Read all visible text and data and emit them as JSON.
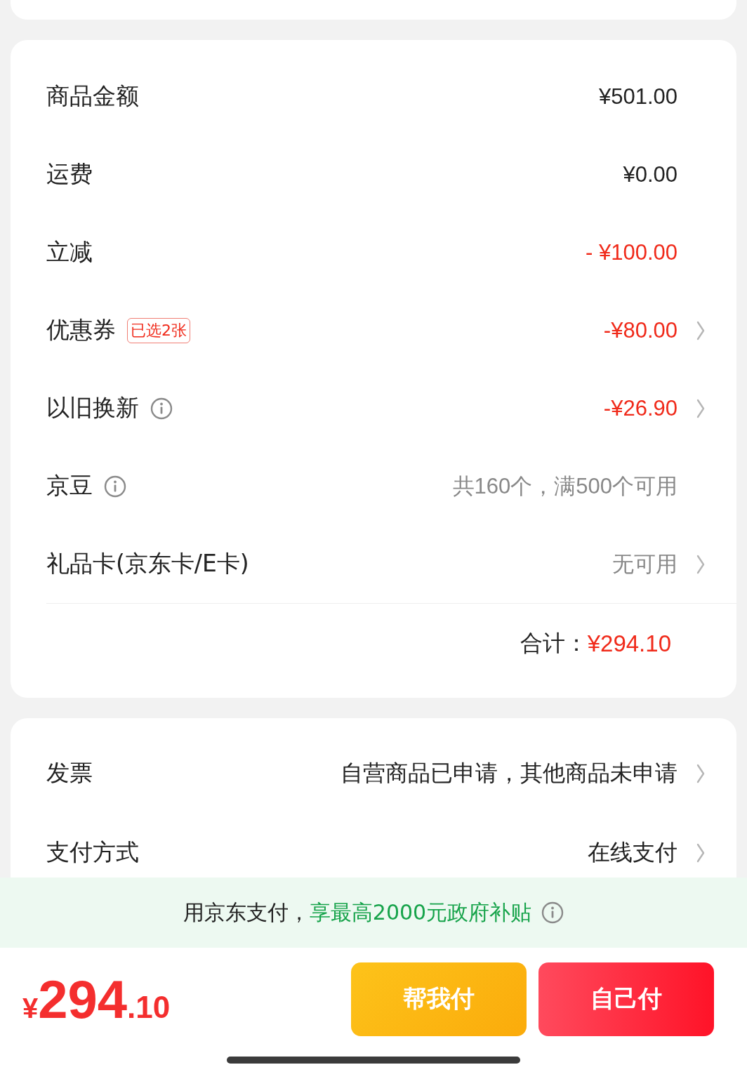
{
  "price_rows": [
    {
      "label": "商品金额",
      "value": "¥501.00",
      "kind": "amount",
      "chevron": false
    },
    {
      "label": "运费",
      "value": "¥0.00",
      "kind": "amount",
      "chevron": false
    },
    {
      "label": "立减",
      "value": "- ¥100.00",
      "kind": "discount",
      "chevron": false
    },
    {
      "label": "优惠券",
      "badge": "已选2张",
      "value": "-¥80.00",
      "kind": "discount",
      "chevron": true
    },
    {
      "label": "以旧换新",
      "info": true,
      "value": "-¥26.90",
      "kind": "discount",
      "chevron": true
    },
    {
      "label": "京豆",
      "info": true,
      "value": "共160个，满500个可用",
      "kind": "muted",
      "chevron": false
    },
    {
      "label": "礼品卡(京东卡/E卡)",
      "value": "无可用",
      "kind": "muted",
      "chevron": true
    }
  ],
  "total": {
    "label": "合计：",
    "value": "¥294.10"
  },
  "order_rows": [
    {
      "label": "发票",
      "value": "自营商品已申请，其他商品未申请",
      "chevron": true
    },
    {
      "label": "支付方式",
      "value": "在线支付",
      "chevron": true
    }
  ],
  "promo": {
    "text": "用京东支付，",
    "highlight": "享最高2000元政府补贴",
    "info": true
  },
  "footer": {
    "price_currency": "¥",
    "price_integer": "294",
    "price_decimal": ".10",
    "buttons": [
      {
        "label": "帮我付",
        "kind": "secondary"
      },
      {
        "label": "自己付",
        "kind": "primary"
      }
    ]
  }
}
